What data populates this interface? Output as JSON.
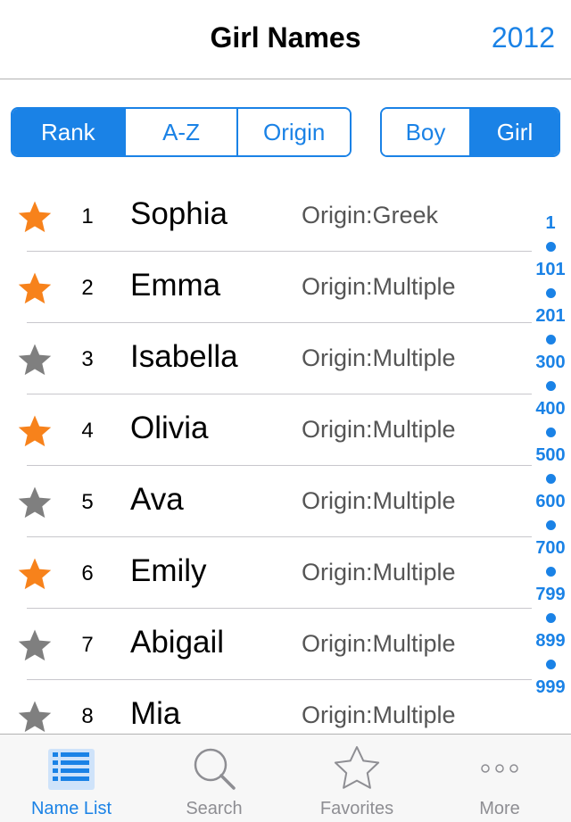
{
  "header": {
    "title": "Girl Names",
    "year": "2012"
  },
  "sort_control": {
    "options": [
      {
        "label": "Rank",
        "selected": true
      },
      {
        "label": "A-Z",
        "selected": false
      },
      {
        "label": "Origin",
        "selected": false
      }
    ]
  },
  "gender_control": {
    "options": [
      {
        "label": "Boy",
        "selected": false
      },
      {
        "label": "Girl",
        "selected": true
      }
    ]
  },
  "colors": {
    "accent": "#1a82e6",
    "favorite_star": "#f7821b",
    "inactive_star": "#7f7f7f"
  },
  "names": [
    {
      "rank": "1",
      "name": "Sophia",
      "origin": "Origin:Greek",
      "favorite": true
    },
    {
      "rank": "2",
      "name": "Emma",
      "origin": "Origin:Multiple",
      "favorite": true
    },
    {
      "rank": "3",
      "name": "Isabella",
      "origin": "Origin:Multiple",
      "favorite": false
    },
    {
      "rank": "4",
      "name": "Olivia",
      "origin": "Origin:Multiple",
      "favorite": true
    },
    {
      "rank": "5",
      "name": "Ava",
      "origin": "Origin:Multiple",
      "favorite": false
    },
    {
      "rank": "6",
      "name": "Emily",
      "origin": "Origin:Multiple",
      "favorite": true
    },
    {
      "rank": "7",
      "name": "Abigail",
      "origin": "Origin:Multiple",
      "favorite": false
    },
    {
      "rank": "8",
      "name": "Mia",
      "origin": "Origin:Multiple",
      "favorite": false
    }
  ],
  "index": [
    "1",
    "101",
    "201",
    "300",
    "400",
    "500",
    "600",
    "700",
    "799",
    "899",
    "999"
  ],
  "tabs": [
    {
      "label": "Name List",
      "icon": "list-icon",
      "active": true
    },
    {
      "label": "Search",
      "icon": "search-icon",
      "active": false
    },
    {
      "label": "Favorites",
      "icon": "star-icon",
      "active": false
    },
    {
      "label": "More",
      "icon": "more-icon",
      "active": false
    }
  ]
}
